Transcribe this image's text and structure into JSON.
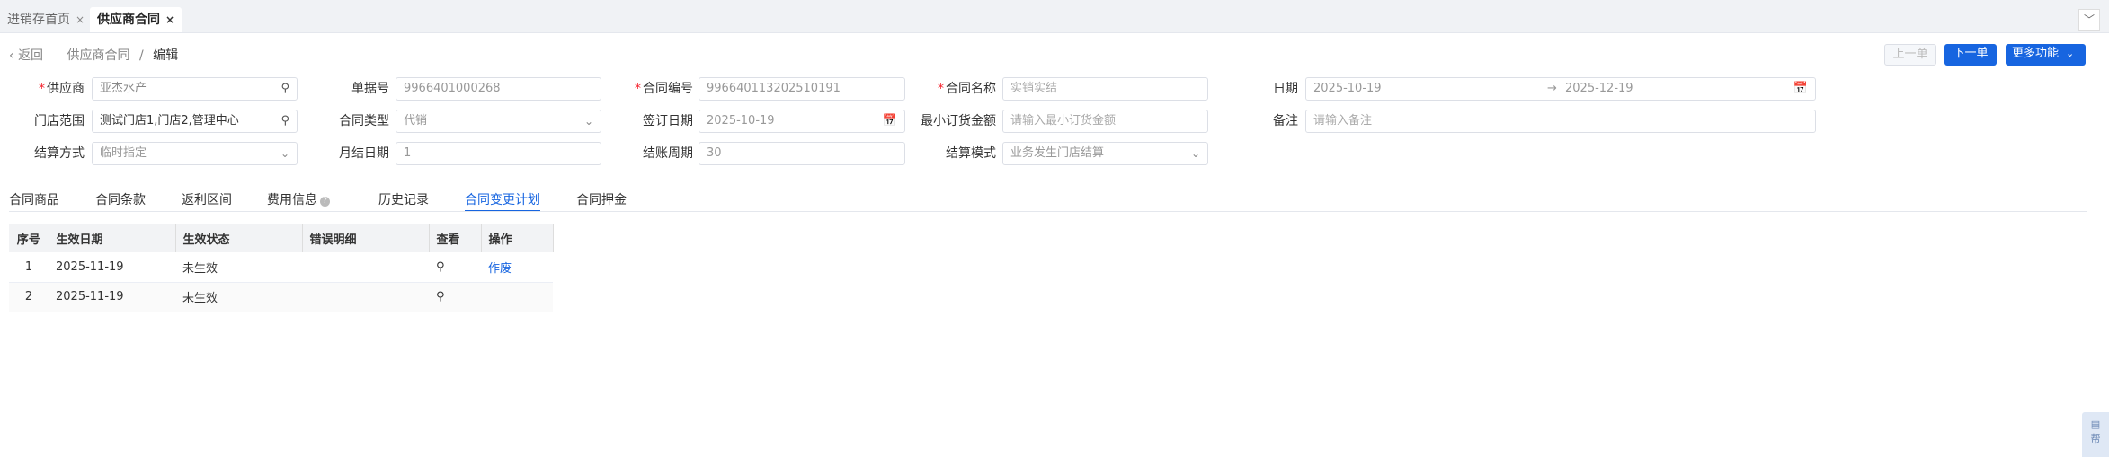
{
  "tabs": [
    {
      "label": "进销存首页",
      "close": "×"
    },
    {
      "label": "供应商合同",
      "close": "×"
    }
  ],
  "header": {
    "collapse": "﹀"
  },
  "breadcrumb": {
    "back": "返回",
    "parent": "供应商合同",
    "sep": "/",
    "current": "编辑"
  },
  "toolbar": {
    "prev": "上一单",
    "next": "下一单",
    "more": "更多功能"
  },
  "form": {
    "supplier": {
      "label": "供应商",
      "value": "亚杰水产"
    },
    "doc_no": {
      "label": "单据号",
      "value": "9966401000268"
    },
    "contract_no": {
      "label": "合同编号",
      "value": "99664011320251019​1"
    },
    "contract_name": {
      "label": "合同名称",
      "placeholder": "实销实结"
    },
    "date": {
      "label": "日期",
      "start": "2025-10-19",
      "arrow": "→",
      "end": "2025-12-19"
    },
    "store_range": {
      "label": "门店范围",
      "value": "测试门店1,门店2,管理中心"
    },
    "contract_type": {
      "label": "合同类型",
      "value": "代销"
    },
    "sign_date": {
      "label": "签订日期",
      "value": "2025-10-19"
    },
    "min_order": {
      "label": "最小订货金额",
      "placeholder": "请输入最小订货金额"
    },
    "remark": {
      "label": "备注",
      "placeholder": "请输入备注"
    },
    "settle_method": {
      "label": "结算方式",
      "value": "临时指定"
    },
    "month_settle_day": {
      "label": "月结日期",
      "value": "1"
    },
    "settle_cycle": {
      "label": "结账周期",
      "value": "30"
    },
    "settle_mode": {
      "label": "结算模式",
      "value": "业务发生门店结算"
    }
  },
  "subtabs": [
    "合同商品",
    "合同条款",
    "返利区间",
    "费用信息",
    "历史记录",
    "合同变更计划",
    "合同押金"
  ],
  "table": {
    "headers": [
      "序号",
      "生效日期",
      "生效状态",
      "错误明细",
      "查看",
      "操作"
    ],
    "rows": [
      {
        "no": "1",
        "date": "2025-11-19",
        "status": "未生效",
        "error": "",
        "action": "作废"
      },
      {
        "no": "2",
        "date": "2025-11-19",
        "status": "未生效",
        "error": "",
        "action": ""
      }
    ]
  },
  "help": {
    "label": "帮"
  },
  "colors": {
    "primary": "#1765e0",
    "required": "#f5222d",
    "tabbar": "#f0f2f5"
  }
}
